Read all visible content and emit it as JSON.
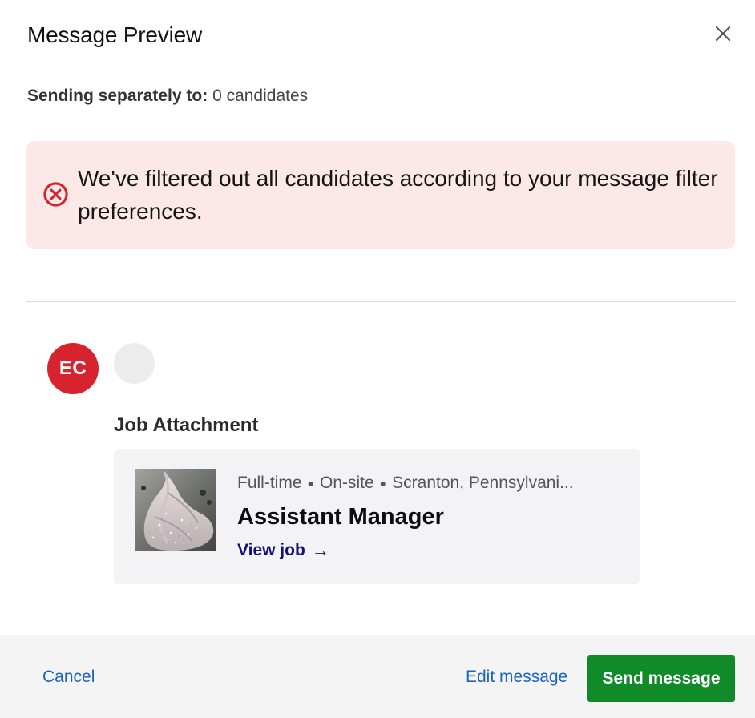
{
  "dialog": {
    "title": "Message Preview"
  },
  "recipients": {
    "label": "Sending separately to:",
    "value": "0 candidates"
  },
  "alert": {
    "icon": "error-circle-icon",
    "color": "#d7232e",
    "background": "#fde8e8",
    "message": "We've filtered out all candidates according to your message filter preferences."
  },
  "sender": {
    "initials": "EC",
    "avatar_color": "#d7232e"
  },
  "attachment": {
    "heading": "Job Attachment",
    "job": {
      "type": "Full-time",
      "workplace": "On-site",
      "location": "Scranton, Pennsylvani...",
      "title": "Assistant Manager",
      "link_label": "View job",
      "link_arrow": "→"
    }
  },
  "footer": {
    "cancel_label": "Cancel",
    "edit_label": "Edit message",
    "send_label": "Send message",
    "send_color": "#118a2a",
    "link_color": "#1a63c7"
  }
}
